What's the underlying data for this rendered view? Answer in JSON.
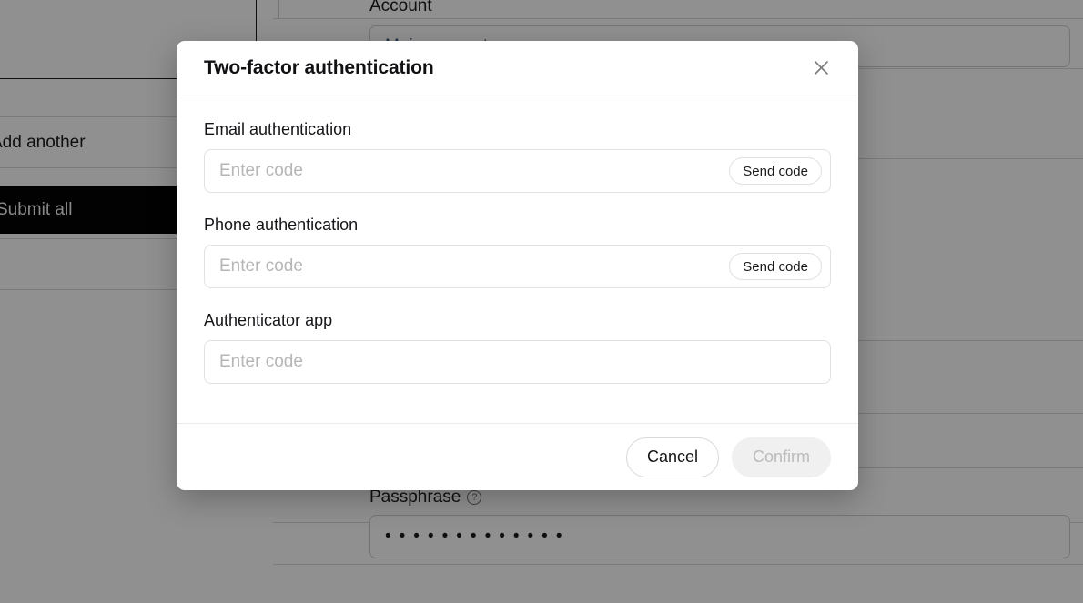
{
  "background": {
    "account_label": "Account",
    "account_value": "Main account",
    "add_another_label": "Add another",
    "submit_all_label": "Submit all",
    "passphrase_label": "Passphrase",
    "passphrase_help_icon": "help-circle-icon",
    "passphrase_masked_value": "•••••••••••••"
  },
  "dialog": {
    "title": "Two-factor authentication",
    "close_icon": "close-icon",
    "fields": [
      {
        "label": "Email authentication",
        "placeholder": "Enter code",
        "value": "",
        "action_label": "Send code",
        "has_action": true
      },
      {
        "label": "Phone authentication",
        "placeholder": "Enter code",
        "value": "",
        "action_label": "Send code",
        "has_action": true
      },
      {
        "label": "Authenticator app",
        "placeholder": "Enter code",
        "value": "",
        "action_label": "",
        "has_action": false
      }
    ],
    "footer": {
      "cancel_label": "Cancel",
      "confirm_label": "Confirm",
      "confirm_disabled": true
    }
  },
  "colors": {
    "scrim": "#000000",
    "dialog_background": "#ffffff",
    "submit_all_background": "#050505",
    "account_value_text": "#3d5a80",
    "placeholder_text": "#b6b6b6",
    "disabled_button_background": "#f0f0f0",
    "disabled_button_text": "#bbbbbb"
  }
}
